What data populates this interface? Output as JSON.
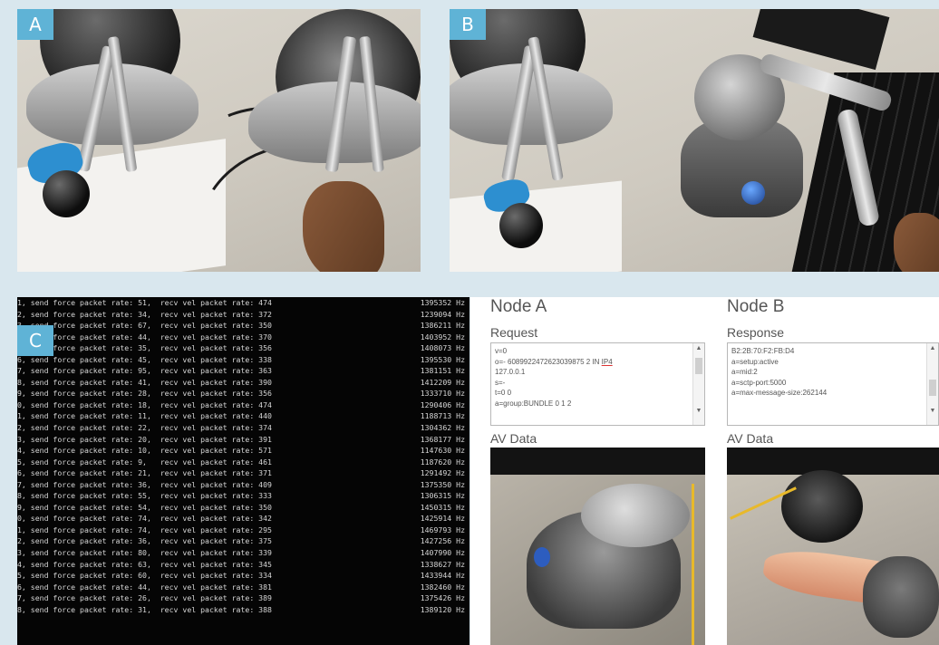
{
  "panels": {
    "a": {
      "label": "A"
    },
    "b": {
      "label": "B"
    },
    "c": {
      "label": "C"
    }
  },
  "terminal": {
    "lines": [
      {
        "text": "1, send force packet rate: 51,  recv vel packet rate: 474",
        "hz": "1395352 Hz"
      },
      {
        "text": "2, send force packet rate: 34,  recv vel packet rate: 372",
        "hz": "1239094 Hz"
      },
      {
        "text": "3, send force packet rate: 67,  recv vel packet rate: 350",
        "hz": "1386211 Hz"
      },
      {
        "text": "4, send force packet rate: 44,  recv vel packet rate: 370",
        "hz": "1403952 Hz"
      },
      {
        "text": "5, send force packet rate: 35,  recv vel packet rate: 356",
        "hz": "1408073 Hz"
      },
      {
        "text": "6, send force packet rate: 45,  recv vel packet rate: 338",
        "hz": "1395530 Hz"
      },
      {
        "text": "7, send force packet rate: 95,  recv vel packet rate: 363",
        "hz": "1381151 Hz"
      },
      {
        "text": "8, send force packet rate: 41,  recv vel packet rate: 390",
        "hz": "1412209 Hz"
      },
      {
        "text": "9, send force packet rate: 28,  recv vel packet rate: 356",
        "hz": "1333710 Hz"
      },
      {
        "text": "0, send force packet rate: 18,  recv vel packet rate: 474",
        "hz": "1290406 Hz"
      },
      {
        "text": "1, send force packet rate: 11,  recv vel packet rate: 440",
        "hz": "1188713 Hz"
      },
      {
        "text": "2, send force packet rate: 22,  recv vel packet rate: 374",
        "hz": "1304362 Hz"
      },
      {
        "text": "3, send force packet rate: 20,  recv vel packet rate: 391",
        "hz": "1368177 Hz"
      },
      {
        "text": "4, send force packet rate: 10,  recv vel packet rate: 571",
        "hz": "1147630 Hz"
      },
      {
        "text": "5, send force packet rate: 9,   recv vel packet rate: 461",
        "hz": "1187620 Hz"
      },
      {
        "text": "6, send force packet rate: 21,  recv vel packet rate: 371",
        "hz": "1291492 Hz"
      },
      {
        "text": "7, send force packet rate: 36,  recv vel packet rate: 409",
        "hz": "1375350 Hz"
      },
      {
        "text": "8, send force packet rate: 55,  recv vel packet rate: 333",
        "hz": "1306315 Hz"
      },
      {
        "text": "9, send force packet rate: 54,  recv vel packet rate: 350",
        "hz": "1450315 Hz"
      },
      {
        "text": "0, send force packet rate: 74,  recv vel packet rate: 342",
        "hz": "1425914 Hz"
      },
      {
        "text": "1, send force packet rate: 74,  recv vel packet rate: 295",
        "hz": "1469793 Hz"
      },
      {
        "text": "2, send force packet rate: 36,  recv vel packet rate: 375",
        "hz": "1427256 Hz"
      },
      {
        "text": "3, send force packet rate: 80,  recv vel packet rate: 339",
        "hz": "1407990 Hz"
      },
      {
        "text": "4, send force packet rate: 63,  recv vel packet rate: 345",
        "hz": "1338627 Hz"
      },
      {
        "text": "5, send force packet rate: 60,  recv vel packet rate: 334",
        "hz": "1433944 Hz"
      },
      {
        "text": "6, send force packet rate: 44,  recv vel packet rate: 381",
        "hz": "1382460 Hz"
      },
      {
        "text": "7, send force packet rate: 26,  recv vel packet rate: 389",
        "hz": "1375426 Hz"
      },
      {
        "text": "8, send force packet rate: 31,  recv vel packet rate: 388",
        "hz": "1389120 Hz"
      }
    ]
  },
  "node_a": {
    "title": "Node A",
    "box_label": "Request",
    "lines": [
      "v=0",
      "o=- 6089922472623039875 2 IN ",
      "127.0.0.1",
      "s=-",
      "t=0 0",
      "a=group:BUNDLE 0 1 2"
    ],
    "underlined": "IP4",
    "av_label": "AV Data"
  },
  "node_b": {
    "title": "Node B",
    "box_label": "Response",
    "lines": [
      "B2:2B:70:F2:FB:D4",
      "a=setup:active",
      "a=mid:2",
      "a=sctp-port:5000",
      "a=max-message-size:262144"
    ],
    "av_label": "AV Data"
  },
  "colors": {
    "badge": "#5fb3d6",
    "background": "#d9e7ee",
    "terminal_bg": "#050505"
  }
}
